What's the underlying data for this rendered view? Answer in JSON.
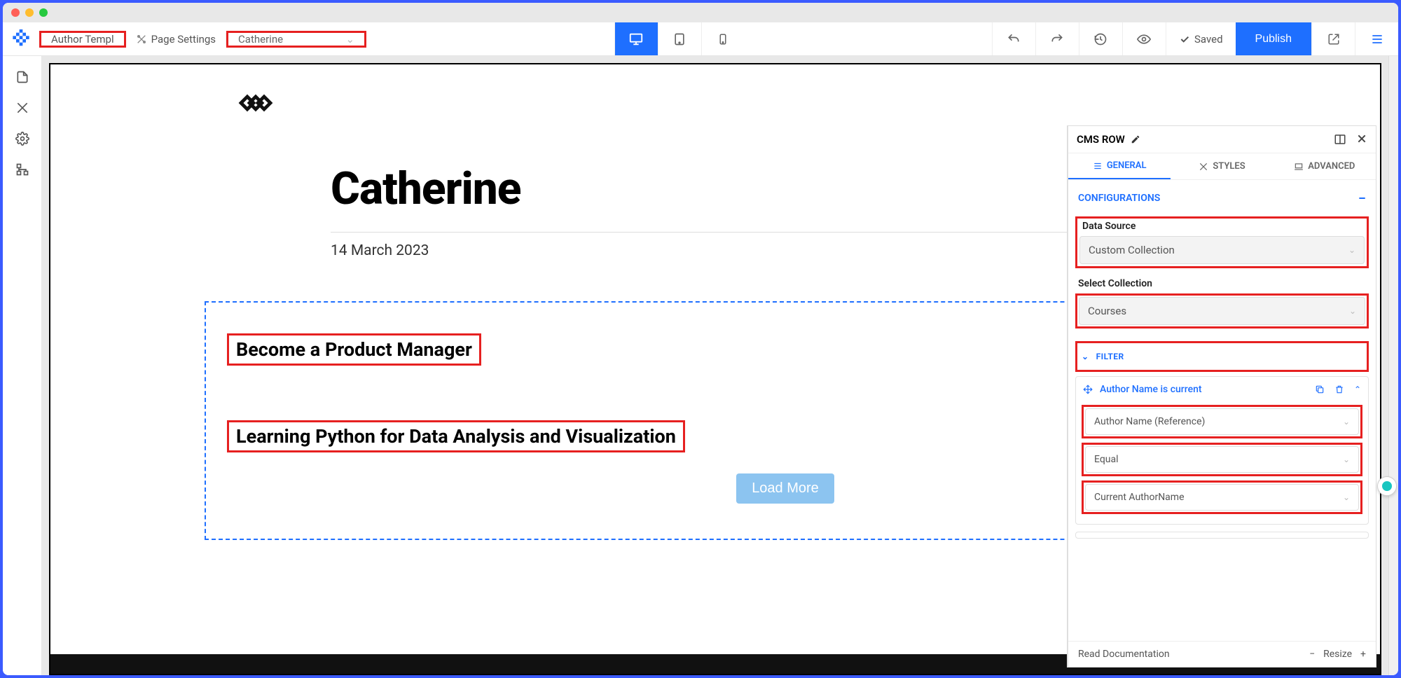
{
  "toolbar": {
    "template_label": "Author Templ",
    "page_settings_label": "Page Settings",
    "page_dropdown_value": "Catherine",
    "saved_label": "Saved",
    "publish_label": "Publish"
  },
  "canvas": {
    "title": "Catherine",
    "date": "14 March 2023",
    "courses": [
      "Become a Product Manager",
      "Learning Python for Data Analysis and Visualization"
    ],
    "load_more": "Load More"
  },
  "panel": {
    "title": "CMS ROW",
    "tabs": {
      "general": "GENERAL",
      "styles": "STYLES",
      "advanced": "ADVANCED"
    },
    "configurations_label": "CONFIGURATIONS",
    "data_source": {
      "label": "Data Source",
      "value": "Custom Collection"
    },
    "collection": {
      "label": "Select Collection",
      "value": "Courses"
    },
    "filter": {
      "label": "FILTER",
      "rule_title": "Author Name is current",
      "field": "Author Name (Reference)",
      "operator": "Equal",
      "value": "Current AuthorName"
    },
    "footer": {
      "docs": "Read Documentation",
      "resize": "Resize",
      "minus": "−",
      "plus": "+"
    }
  }
}
